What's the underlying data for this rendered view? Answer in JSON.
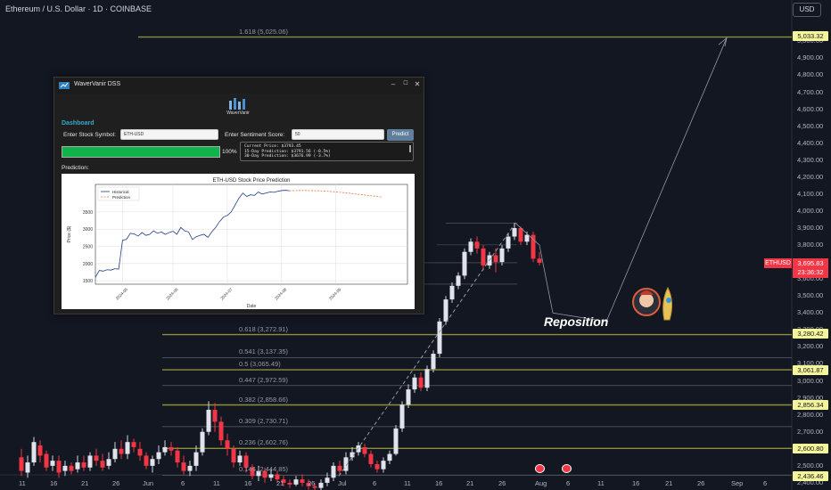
{
  "header": {
    "symbol_title": "Ethereum / U.S. Dollar · 1D · COINBASE",
    "currency": "USD"
  },
  "annotation": {
    "reposition": "Reposition"
  },
  "ticker": {
    "symbol": "ETHUSD",
    "price": "3,695.83",
    "countdown": "23:36:32"
  },
  "price_axis": [
    "5,000.00",
    "4,900.00",
    "4,800.00",
    "4,700.00",
    "4,600.00",
    "4,500.00",
    "4,400.00",
    "4,300.00",
    "4,200.00",
    "4,100.00",
    "4,000.00",
    "3,900.00",
    "3,800.00",
    "3,700.00",
    "3,600.00",
    "3,500.00",
    "3,400.00",
    "3,300.00",
    "3,200.00",
    "3,100.00",
    "3,000.00",
    "2,900.00",
    "2,800.00",
    "2,700.00",
    "2,600.00",
    "2,500.00",
    "2,400.00"
  ],
  "price_tags": [
    "5,033.32",
    "3,280.42",
    "3,061.87",
    "2,856.34",
    "2,600.80",
    "2,436.46"
  ],
  "fib_labels": [
    "1.618 (5,025.06)",
    "0.618 (3,272.91)",
    "0.541 (3,137.35)",
    "0.5 (3,065.49)",
    "0.447 (2,972.59)",
    "0.382 (2,858.66)",
    "0.309 (2,730.71)",
    "0.236 (2,602.76)",
    "0.146 (2,444.85)"
  ],
  "x_axis": [
    "11",
    "16",
    "21",
    "26",
    "Jun",
    "6",
    "11",
    "16",
    "21",
    "26",
    "Jul",
    "6",
    "11",
    "16",
    "21",
    "26",
    "Aug",
    "6",
    "11",
    "16",
    "21",
    "26",
    "Sep",
    "6"
  ],
  "app": {
    "window_title": "WaverVanir DSS",
    "window_controls": [
      "–",
      "☐",
      "✕"
    ],
    "logo_text": "WaverVanir",
    "dashboard_label": "Dashboard",
    "stock_label": "Enter Stock Symbol:",
    "stock_value": "ETH-USD",
    "sentiment_label": "Enter Sentiment Score:",
    "sentiment_value": "50",
    "predict_label": "Predict",
    "progress": 1.0,
    "progress_label": "100%",
    "output_lines": [
      "Current Price: $3793.45",
      "15-Day Prediction: $3791.56 (-0.5%)",
      "30-Day Prediction: $3676.99 (-3.7%)"
    ],
    "prediction_label": "Prediction:"
  },
  "chart_data": {
    "type": "line",
    "title": "ETH-USD Stock Price Prediction",
    "xlabel": "Date",
    "ylabel": "Price ($)",
    "x_ticks": [
      "2024-05",
      "2024-06",
      "2024-07",
      "2024-08",
      "2024-09"
    ],
    "y_ticks": [
      1500,
      2000,
      2500,
      3000,
      3500
    ],
    "ylim": [
      1400,
      4300
    ],
    "grid": true,
    "legend_position": "top-left",
    "series": [
      {
        "name": "Historical",
        "color": "#1f3c88",
        "style": "solid",
        "x": [
          0,
          2,
          4,
          6,
          8,
          10,
          12,
          14,
          16,
          18,
          20,
          22,
          24,
          26,
          28,
          30,
          32,
          34,
          36,
          38,
          40,
          42,
          44,
          46,
          48,
          50,
          52,
          54,
          56,
          58,
          60,
          62,
          64,
          66,
          68,
          70,
          72,
          74,
          76,
          78,
          80,
          82,
          84,
          86,
          88,
          90,
          92,
          94,
          96,
          98,
          100
        ],
        "y": [
          1600,
          1800,
          1780,
          1820,
          1810,
          1850,
          1840,
          2680,
          2700,
          2880,
          2860,
          2800,
          2900,
          2820,
          2850,
          2950,
          2880,
          2920,
          2850,
          2900,
          2940,
          2850,
          3050,
          2950,
          2920,
          2700,
          2780,
          2820,
          2850,
          2760,
          2920,
          3050,
          3220,
          3350,
          3400,
          3500,
          3700,
          3900,
          4050,
          3950,
          4000,
          3980,
          4080,
          4020,
          4050,
          4080,
          4070,
          4100,
          4120,
          4130,
          4115
        ]
      },
      {
        "name": "Prediction",
        "color": "#e8733a",
        "style": "dashed",
        "x": [
          100,
          106,
          112,
          118,
          124,
          130,
          136,
          142,
          148
        ],
        "y": [
          4115,
          4125,
          4120,
          4110,
          4080,
          4050,
          4010,
          3970,
          3930
        ]
      }
    ]
  }
}
